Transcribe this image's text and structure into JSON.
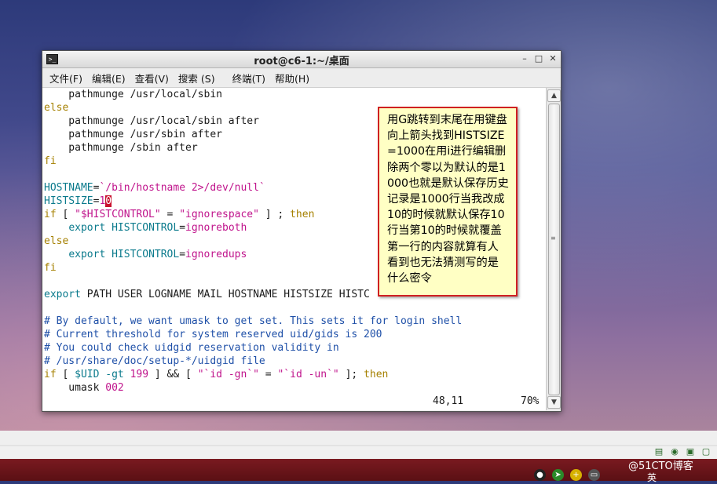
{
  "window": {
    "title": "root@c6-1:~/桌面",
    "minimize": "–",
    "maximize": "□",
    "close": "✕",
    "icon": "terminal-icon"
  },
  "menu": [
    "文件(F)",
    "编辑(E)",
    "查看(V)",
    "搜索 (S)",
    "终端(T)",
    "帮助(H)"
  ],
  "lines": [
    "    pathmunge /usr/local/sbin",
    "else",
    "    pathmunge /usr/local/sbin after",
    "    pathmunge /usr/sbin after",
    "    pathmunge /sbin after",
    "fi",
    "",
    "HOSTNAME=`/bin/hostname 2>/dev/null`",
    "HISTSIZE=10",
    "if [ \"$HISTCONTROL\" = \"ignorespace\" ] ; then",
    "    export HISTCONTROL=ignoreboth",
    "else",
    "    export HISTCONTROL=ignoredups",
    "fi",
    "",
    "export PATH USER LOGNAME MAIL HOSTNAME HISTSIZE HISTC",
    "",
    "# By default, we want umask to get set. This sets it for login shell",
    "# Current threshold for system reserved uid/gids is 200",
    "# You could check uidgid reservation validity in",
    "# /usr/share/doc/setup-*/uidgid file",
    "if [ $UID -gt 199 ] && [ \"`id -gn`\" = \"`id -un`\" ]; then",
    "    umask 002"
  ],
  "status": {
    "position": "48,11",
    "percent": "70%"
  },
  "annotation": "用G跳转到末尾在用键盘向上箭头找到HISTSIZE=1000在用i进行编辑删除两个零以为默认的是1000也就是默认保存历史记录是1000行当我改成10的时候就默认保存10行当第10的时候就覆盖第一行的内容就算有人看到也无法猜测写的是什么密令",
  "watermark": "@51CTO博客",
  "ime": "英",
  "colors": {
    "keyword": "#a58000",
    "variable": "#0a7a8c",
    "string": "#c0148c",
    "comment": "#1f50a8",
    "cursor": "#c8102e",
    "annotation_border": "#d02020",
    "annotation_bg": "#ffffc4"
  }
}
